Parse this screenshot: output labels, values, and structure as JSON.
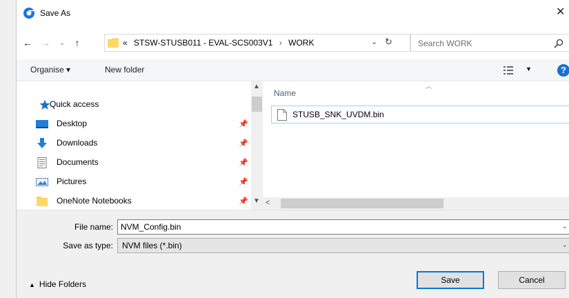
{
  "window": {
    "title": "Save As",
    "close_glyph": "✕"
  },
  "icons": {
    "app": "chromium-app-icon",
    "back": "back-arrow-icon",
    "forward": "forward-arrow-icon",
    "recent": "chevron-down-icon",
    "up": "up-arrow-icon",
    "search": "search-icon",
    "refresh": "refresh-icon",
    "view": "view-options-icon",
    "help": "help-icon",
    "pin": "pin-icon"
  },
  "address": {
    "overflow": "«",
    "segments": [
      "STSW-STUSB011 - EVAL-SCS003V1",
      "WORK"
    ],
    "separator": "›"
  },
  "search": {
    "placeholder": "Search WORK"
  },
  "toolbar": {
    "organise_label": "Organise ▾",
    "new_folder_label": "New folder",
    "help_label": "?"
  },
  "nav": {
    "quick_access": "Quick access",
    "items": [
      {
        "label": "Desktop",
        "icon": "desktop-icon",
        "pin": "📌"
      },
      {
        "label": "Downloads",
        "icon": "downloads-icon",
        "pin": "📌"
      },
      {
        "label": "Documents",
        "icon": "documents-icon",
        "pin": "📌"
      },
      {
        "label": "Pictures",
        "icon": "pictures-icon",
        "pin": "📌"
      },
      {
        "label": "OneNote Notebooks",
        "icon": "folder-icon",
        "pin": "📌"
      }
    ]
  },
  "files": {
    "column_name": "Name",
    "rows": [
      {
        "name": "STUSB_SNK_UVDM.bin",
        "icon": "file-icon"
      }
    ]
  },
  "form": {
    "file_name_label": "File name:",
    "file_name_value": "NVM_Config.bin",
    "save_type_label": "Save as type:",
    "save_type_value": "NVM files (*.bin)"
  },
  "footer": {
    "hide_folders_label": "Hide Folders",
    "save_label": "Save",
    "cancel_label": "Cancel"
  },
  "colors": {
    "accent": "#0078d7",
    "selection_border": "#99d1ff",
    "folder": "#f7cf5a",
    "help": "#1a6fcf"
  }
}
